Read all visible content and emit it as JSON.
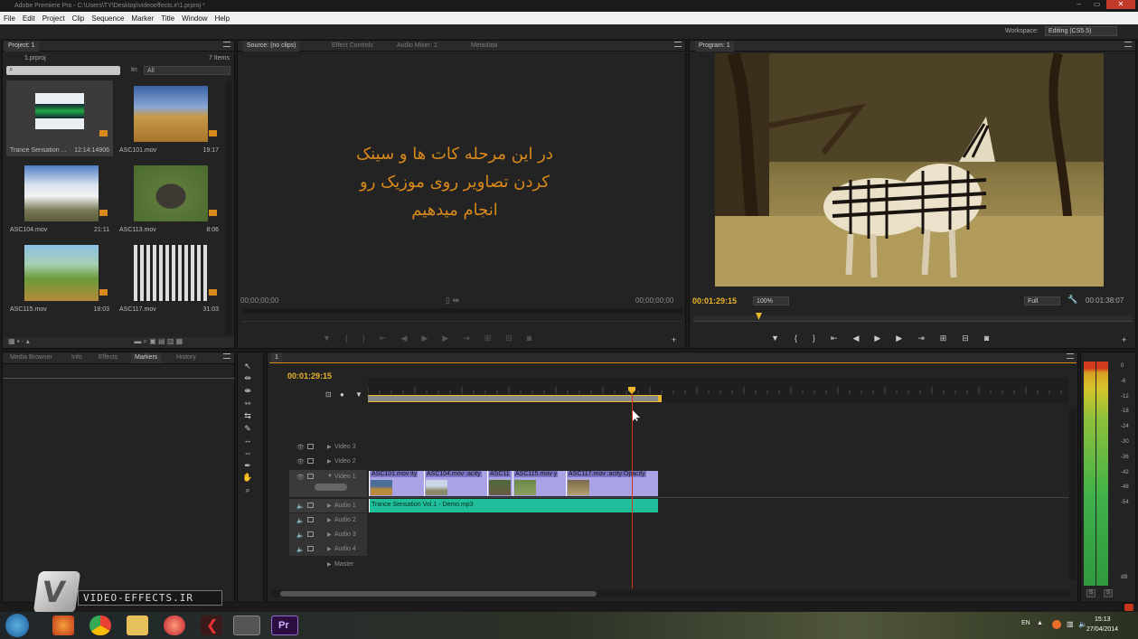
{
  "window": {
    "title": "Adobe Premiere Pro - C:\\Users\\TY\\Desktop\\videoeffects.ir\\1.prproj *"
  },
  "menu": [
    "File",
    "Edit",
    "Project",
    "Clip",
    "Sequence",
    "Marker",
    "Title",
    "Window",
    "Help"
  ],
  "workspace": {
    "label": "Workspace:",
    "value": "Editing (CS5.5)"
  },
  "project": {
    "tab": "Project: 1",
    "file": "1.prproj",
    "count": "7 Items",
    "in_label": "In:",
    "in_value": "All",
    "items": [
      {
        "name": "Trance Sensation ...",
        "dur": "12:14:14906",
        "kind": "audio"
      },
      {
        "name": "ASC101.mov",
        "dur": "19:17",
        "kind": "savanna"
      },
      {
        "name": "ASC104.mov",
        "dur": "21:11",
        "kind": "clouds"
      },
      {
        "name": "ASC113.mov",
        "dur": "8:06",
        "kind": "elephant"
      },
      {
        "name": "ASC115.mov",
        "dur": "18:03",
        "kind": "giraffe"
      },
      {
        "name": "ASC117.mov",
        "dur": "31:03",
        "kind": "zebra"
      }
    ]
  },
  "source": {
    "tabs": [
      "Source: (no clips)",
      "Effect Controls",
      "Audio Mixer: 1",
      "Metadata"
    ],
    "overlay": [
      "در این مرحله کات ها و سینک",
      "کردن تصاویر روی موزیک رو",
      "انجام میدهیم"
    ],
    "tc_in": "00;00;00;00",
    "tc_out": "00;00;00;00"
  },
  "program": {
    "tab": "Program: 1",
    "tc": "00:01:29:15",
    "zoom": "100%",
    "quality": "Full",
    "duration": "00:01:38:07"
  },
  "lower_tabs": [
    "Media Browser",
    "Info",
    "Effects",
    "Markers",
    "History"
  ],
  "timeline": {
    "tab": "1",
    "tc": "00:01:29:15",
    "video_tracks": [
      "Video 3",
      "Video 2",
      "Video 1"
    ],
    "audio_tracks": [
      "Audio 1",
      "Audio 2",
      "Audio 3",
      "Audio 4"
    ],
    "master": "Master",
    "clips": [
      {
        "label": "ASC101.mov ity",
        "kind": "savanna"
      },
      {
        "label": "ASC104.mov :acity",
        "kind": "clouds"
      },
      {
        "label": "ASC11",
        "kind": "elephant"
      },
      {
        "label": "ASC115.mov y",
        "kind": "giraffe"
      },
      {
        "label": "ASC117.mov :acity:Opacity",
        "kind": "zebra"
      }
    ],
    "audio_clip": "Trance Sensation Vol.1 - Demo.mp3"
  },
  "meter": {
    "labels": [
      "0",
      "-6",
      "-12",
      "-18",
      "-24",
      "-30",
      "-36",
      "-42",
      "-48",
      "-54",
      "dB"
    ],
    "solo": [
      "S",
      "S"
    ]
  },
  "watermark": "VIDEO-EFFECTS.IR",
  "tray": {
    "lang": "EN",
    "time": "15:13",
    "date": "27/04/2014"
  },
  "colors": {
    "accent": "#e8b52b",
    "clip_video": "#a9a2e5",
    "clip_audio": "#1fbf9c",
    "playhead": "#d0361b"
  }
}
